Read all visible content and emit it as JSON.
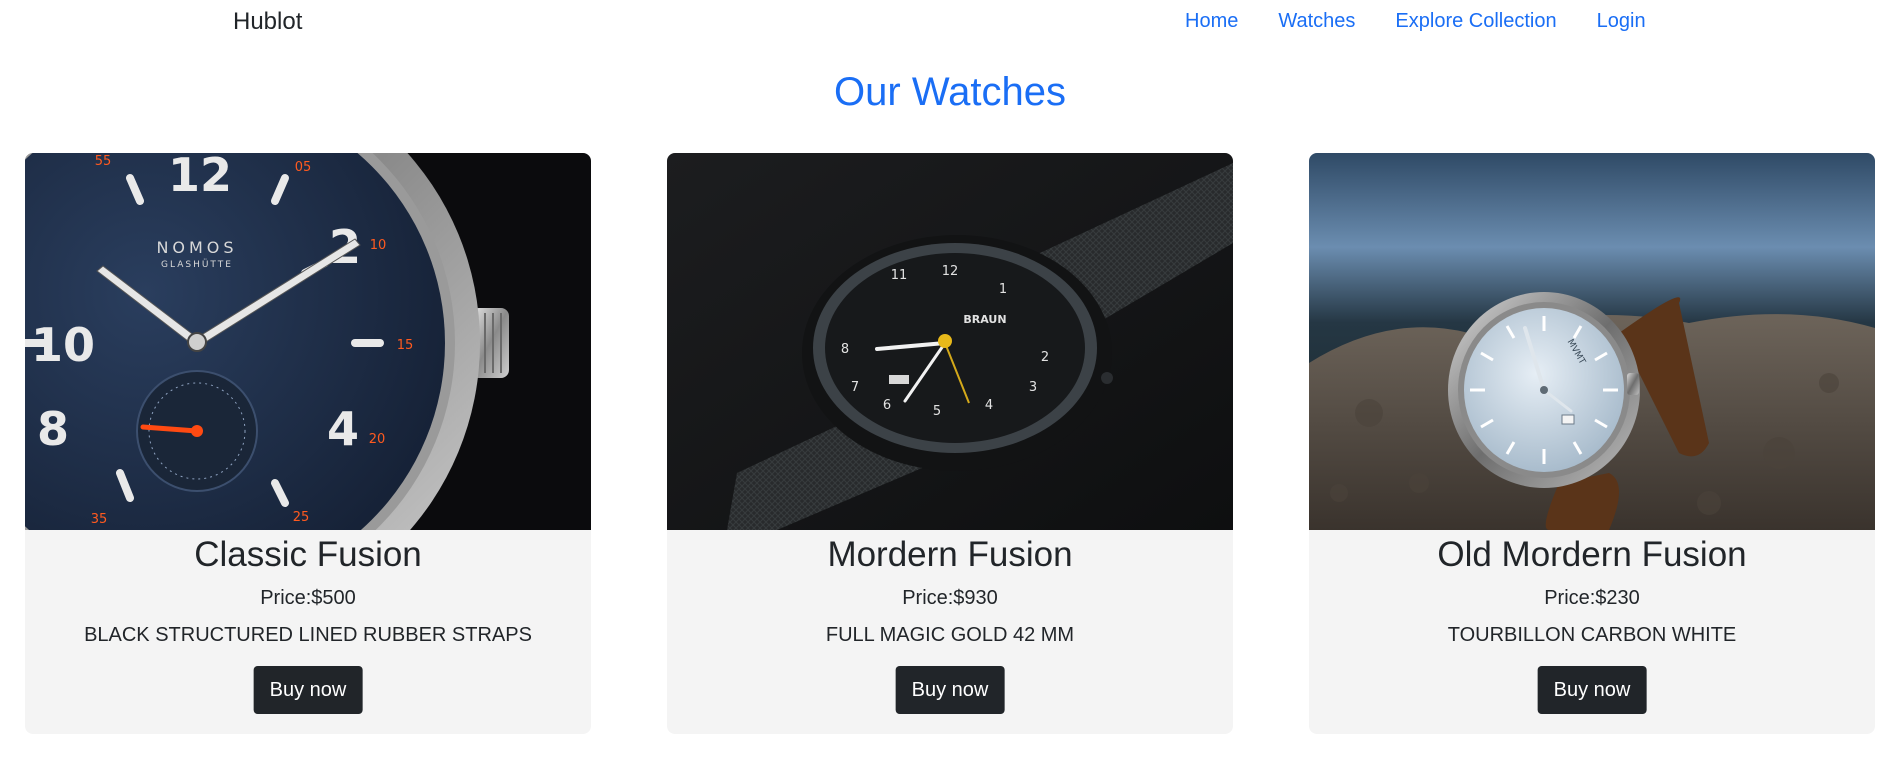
{
  "navbar": {
    "brand": "Hublot",
    "links": [
      {
        "label": "Home"
      },
      {
        "label": "Watches"
      },
      {
        "label": "Explore Collection"
      },
      {
        "label": "Login"
      }
    ]
  },
  "main": {
    "title": "Our Watches",
    "products": [
      {
        "name": "Classic Fusion",
        "price": "Price:$500",
        "description": "BLACK STRUCTURED LINED RUBBER STRAPS",
        "button": "Buy now"
      },
      {
        "name": "Mordern Fusion",
        "price": "Price:$930",
        "description": "FULL MAGIC GOLD 42 MM",
        "button": "Buy now"
      },
      {
        "name": "Old Mordern Fusion",
        "price": "Price:$230",
        "description": "TOURBILLON CARBON WHITE",
        "button": "Buy now"
      }
    ],
    "images": {
      "classic": {
        "brand_text": "NOMOS",
        "sub_text": "GLASHÜTTE",
        "numerals": [
          "12",
          "10",
          "2",
          "8",
          "4"
        ],
        "bezel": [
          "55",
          "05",
          "10",
          "15",
          "20",
          "25",
          "35"
        ]
      },
      "modern": {
        "brand_text": "BRAUN",
        "numerals": [
          "11",
          "12",
          "1",
          "8",
          "2",
          "7",
          "3",
          "6",
          "5",
          "4"
        ]
      },
      "old_modern": {
        "brand_text": "MVMT"
      }
    }
  },
  "colors": {
    "accent": "#1a6ef5",
    "card_bg": "#f4f4f4",
    "button_bg": "#212529",
    "button_text": "#ffffff"
  }
}
